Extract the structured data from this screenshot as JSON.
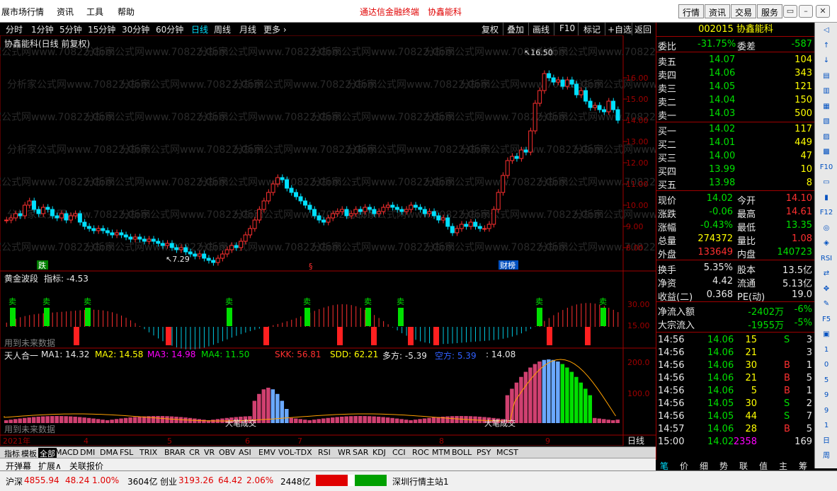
{
  "menu": {
    "items": [
      "展市场行情",
      "资讯",
      "工具",
      "帮助"
    ],
    "center_links": [
      "通达信金融终端",
      "协鑫能科"
    ],
    "right_buttons": [
      "行情",
      "资讯",
      "交易",
      "服务"
    ],
    "window_buttons": [
      "▭",
      "–",
      "▢",
      "✕"
    ]
  },
  "periods": [
    "分时",
    "1分钟",
    "5分钟",
    "15分钟",
    "30分钟",
    "60分钟",
    "日线",
    "周线",
    "月线",
    "更多 ›"
  ],
  "active_period": "日线",
  "tools": [
    "复权",
    "叠加",
    "画线",
    "F10",
    "标记",
    "+自选",
    "返回"
  ],
  "main_chart": {
    "title": "协鑫能科(日线 前复权)",
    "high_label": "16.50",
    "low_label": "7.29",
    "y_ticks": [
      "16.00",
      "15.00",
      "14.00",
      "13.00",
      "12.00",
      "11.00",
      "10.00",
      "9.00",
      "8.00"
    ],
    "markers": [
      "跌",
      "§",
      "财榜"
    ],
    "watermark": "分析家公式网www.70822.Com"
  },
  "panel2": {
    "title": "黄金波段",
    "indicator_label": "指标: -4.53",
    "y_ticks": [
      "30.00",
      "15.00"
    ],
    "sell_label": "卖",
    "buy_label": "买",
    "future_note": "用到未来数据"
  },
  "panel3": {
    "title": "天人合一",
    "ma1": "MA1: 14.32",
    "ma2": "MA2: 14.58",
    "ma3": "MA3: 14.98",
    "ma4": "MA4: 11.50",
    "skk": "SKK: 56.81",
    "sdd": "SDD: 62.21",
    "duofang": "多方: -5.39",
    "kongfang": "空方: 5.39",
    "last": ": 14.08",
    "y_ticks": [
      "200.0",
      "100.0"
    ],
    "future_note": "用到未来数据",
    "annotation": "大笔成交"
  },
  "x_axis": {
    "labels": [
      "2021年",
      "4",
      "5",
      "6",
      "7",
      "8",
      "9"
    ],
    "day_label": "日线"
  },
  "indicator_tabs": [
    "指标",
    "模板",
    "全部",
    "MACD",
    "DMI",
    "DMA",
    "FSL",
    "TRIX",
    "BRAR",
    "CR",
    "VR",
    "OBV",
    "ASI",
    "EMV",
    "VOL-TDX",
    "RSI",
    "WR",
    "SAR",
    "KDJ",
    "CCI",
    "ROC",
    "MTM",
    "BOLL",
    "PSY",
    "MCST"
  ],
  "active_indicator_tab": "全部",
  "sub_tabs": [
    "开弹幕",
    "扩展∧",
    "关联报价"
  ],
  "quote": {
    "code_name": "002015 协鑫能科",
    "weibi_label": "委比",
    "weibi": "-31.75%",
    "weicha_label": "委差",
    "weicha": "-587",
    "asks": [
      {
        "label": "卖五",
        "price": "14.07",
        "vol": "104"
      },
      {
        "label": "卖四",
        "price": "14.06",
        "vol": "343"
      },
      {
        "label": "卖三",
        "price": "14.05",
        "vol": "121"
      },
      {
        "label": "卖二",
        "price": "14.04",
        "vol": "150"
      },
      {
        "label": "卖一",
        "price": "14.03",
        "vol": "500"
      }
    ],
    "bids": [
      {
        "label": "买一",
        "price": "14.02",
        "vol": "117"
      },
      {
        "label": "买二",
        "price": "14.01",
        "vol": "449"
      },
      {
        "label": "买三",
        "price": "14.00",
        "vol": "47"
      },
      {
        "label": "买四",
        "price": "13.99",
        "vol": "10"
      },
      {
        "label": "买五",
        "price": "13.98",
        "vol": "8"
      }
    ],
    "stats": [
      {
        "l1": "现价",
        "v1": "14.02",
        "l2": "今开",
        "v2": "14.10"
      },
      {
        "l1": "涨跌",
        "v1": "-0.06",
        "l2": "最高",
        "v2": "14.61"
      },
      {
        "l1": "涨幅",
        "v1": "-0.43%",
        "l2": "最低",
        "v2": "13.35"
      },
      {
        "l1": "总量",
        "v1": "274372",
        "l2": "量比",
        "v2": "1.08"
      },
      {
        "l1": "外盘",
        "v1": "133649",
        "l2": "内盘",
        "v2": "140723"
      }
    ],
    "fund": [
      {
        "l1": "换手",
        "v1": "5.35%",
        "l2": "股本",
        "v2": "13.5亿"
      },
      {
        "l1": "净资",
        "v1": "4.42",
        "l2": "流通",
        "v2": "5.13亿"
      },
      {
        "l1": "收益(二)",
        "v1": "0.368",
        "l2": "PE(动)",
        "v2": "19.0"
      }
    ],
    "flow": [
      {
        "label": "净流入额",
        "value": "-2402万",
        "pct": "-6%"
      },
      {
        "label": "大宗流入",
        "value": "-1955万",
        "pct": "-5%"
      }
    ],
    "ticks": [
      {
        "t": "14:56",
        "p": "14.06",
        "v": "15",
        "bs": "S",
        "n": "3"
      },
      {
        "t": "14:56",
        "p": "14.06",
        "v": "21",
        "bs": "",
        "n": "3"
      },
      {
        "t": "14:56",
        "p": "14.06",
        "v": "30",
        "bs": "B",
        "n": "1"
      },
      {
        "t": "14:56",
        "p": "14.06",
        "v": "21",
        "bs": "B",
        "n": "5"
      },
      {
        "t": "14:56",
        "p": "14.06",
        "v": "5",
        "bs": "B",
        "n": "1"
      },
      {
        "t": "14:56",
        "p": "14.05",
        "v": "30",
        "bs": "S",
        "n": "2"
      },
      {
        "t": "14:56",
        "p": "14.05",
        "v": "44",
        "bs": "S",
        "n": "7"
      },
      {
        "t": "14:57",
        "p": "14.06",
        "v": "28",
        "bs": "B",
        "n": "5"
      },
      {
        "t": "15:00",
        "p": "14.02",
        "v": "2358",
        "bs": "",
        "n": "169"
      }
    ],
    "bottom_tabs": [
      "笔",
      "价",
      "细",
      "势",
      "联",
      "值",
      "主",
      "筹"
    ]
  },
  "status": {
    "sh_label": "沪深",
    "sh_val": "4855.94",
    "sh_chg": "48.24",
    "sh_pct": "1.00%",
    "sh_amt": "3604亿",
    "cy_label": "创业",
    "cy_val": "3193.26",
    "cy_chg": "64.42",
    "cy_pct": "2.06%",
    "cy_amt": "2448亿",
    "server": "深圳行情主站1"
  },
  "strip_icons": [
    "◁",
    "↑",
    "↓",
    "▤",
    "▥",
    "▦",
    "▧",
    "▨",
    "▩",
    "F10",
    "▭",
    "▮",
    "F12",
    "◎",
    "◈",
    "RSI",
    "⇄",
    "✥",
    "✎",
    "F5",
    "▣",
    "1",
    "0",
    "5",
    "9",
    "9",
    "1",
    "日",
    "周"
  ]
}
